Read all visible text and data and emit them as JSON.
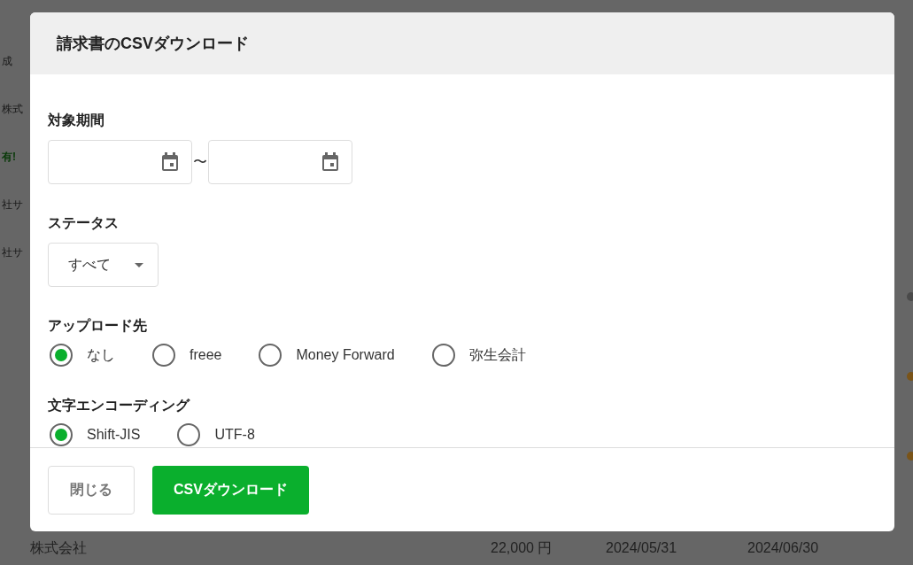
{
  "background": {
    "left_fragments": [
      {
        "text": "成",
        "kind": "text"
      },
      {
        "text": "株式",
        "kind": "text"
      },
      {
        "text": "有!",
        "kind": "notice"
      },
      {
        "text": "社サ",
        "kind": "text"
      },
      {
        "text": "社サ",
        "kind": "text"
      }
    ],
    "status_dots": [
      {
        "color": "#4a4a4a"
      },
      {
        "color": "#7a5418"
      },
      {
        "color": "#7a5418"
      }
    ],
    "bottom_row": [
      "株式会社",
      "22,000 円",
      "2024/05/31",
      "2024/06/30"
    ]
  },
  "dialog": {
    "title": "請求書のCSVダウンロード",
    "period": {
      "label": "対象期間",
      "separator": "〜"
    },
    "status": {
      "label": "ステータス",
      "value": "すべて"
    },
    "upload": {
      "label": "アップロード先",
      "options": [
        {
          "label": "なし",
          "selected": true
        },
        {
          "label": "freee",
          "selected": false
        },
        {
          "label": "Money Forward",
          "selected": false
        },
        {
          "label": "弥生会計",
          "selected": false
        }
      ]
    },
    "encoding": {
      "label": "文字エンコーディング",
      "options": [
        {
          "label": "Shift-JIS",
          "selected": true
        },
        {
          "label": "UTF-8",
          "selected": false
        }
      ]
    },
    "buttons": [
      {
        "label": "閉じる",
        "kind": "secondary"
      },
      {
        "label": "CSVダウンロード",
        "kind": "primary"
      }
    ]
  }
}
